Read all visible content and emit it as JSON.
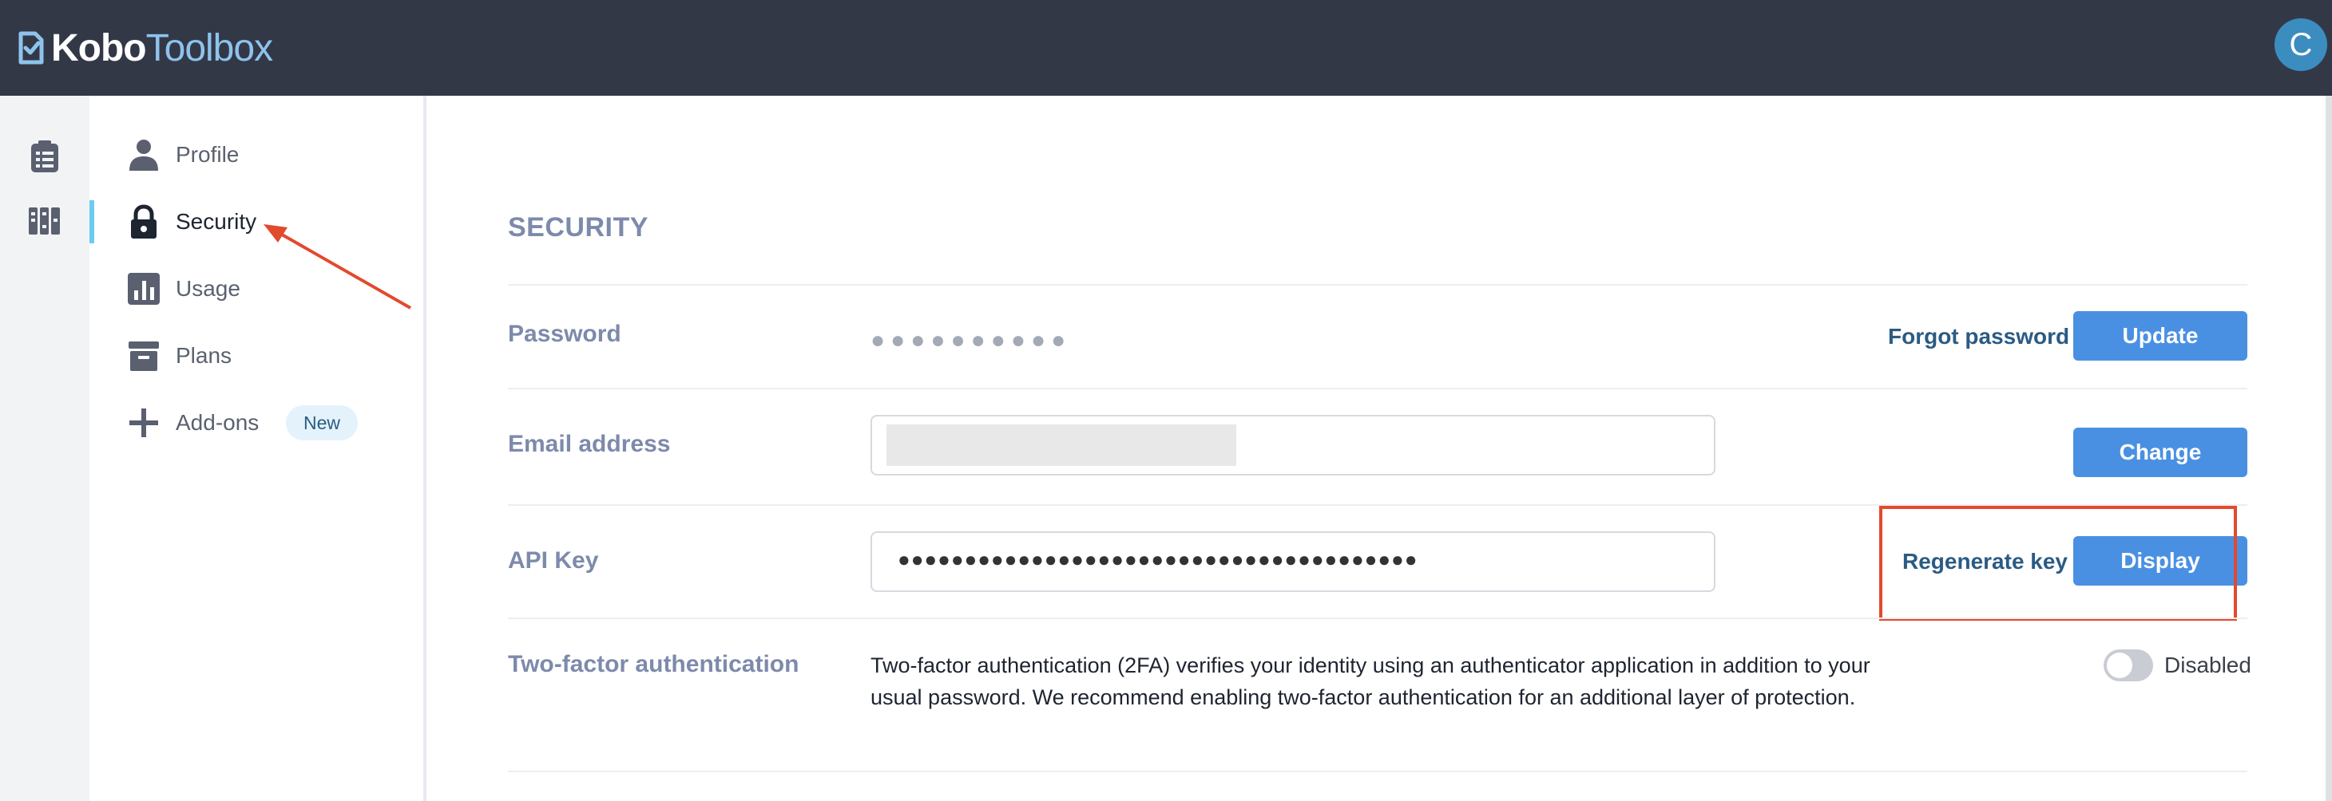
{
  "app": {
    "logo_bold": "Kobo",
    "logo_light": "Toolbox",
    "avatar_letter": "C"
  },
  "rail": {
    "icons": [
      "clipboard-list-icon",
      "library-books-icon"
    ]
  },
  "sidenav": {
    "items": [
      {
        "label": "Profile",
        "icon": "person-icon"
      },
      {
        "label": "Security",
        "icon": "lock-icon",
        "active": true
      },
      {
        "label": "Usage",
        "icon": "bar-chart-icon"
      },
      {
        "label": "Plans",
        "icon": "archive-box-icon"
      },
      {
        "label": "Add-ons",
        "icon": "plus-icon",
        "badge": "New"
      }
    ]
  },
  "security": {
    "title": "SECURITY",
    "password": {
      "label": "Password",
      "masked": "●●●●●●●●●●",
      "forgot_label": "Forgot password",
      "update_label": "Update"
    },
    "email": {
      "label": "Email address",
      "change_label": "Change"
    },
    "api_key": {
      "label": "API Key",
      "masked": "●●●●●●●●●●●●●●●●●●●●●●●●●●●●●●●●●●●●●●●",
      "regenerate_label": "Regenerate key",
      "display_label": "Display"
    },
    "two_factor": {
      "label": "Two-factor authentication",
      "description": "Two-factor authentication (2FA) verifies your identity using an authenticator application in addition to your usual password. We recommend enabling two-factor authentication for an additional layer of protection.",
      "status": "Disabled",
      "enabled": false
    }
  },
  "colors": {
    "topbar": "#333847",
    "accent_button": "#4a90e2",
    "link": "#2b5b84",
    "annotation": "#e24a2e",
    "active_indicator": "#6ccbf0"
  }
}
